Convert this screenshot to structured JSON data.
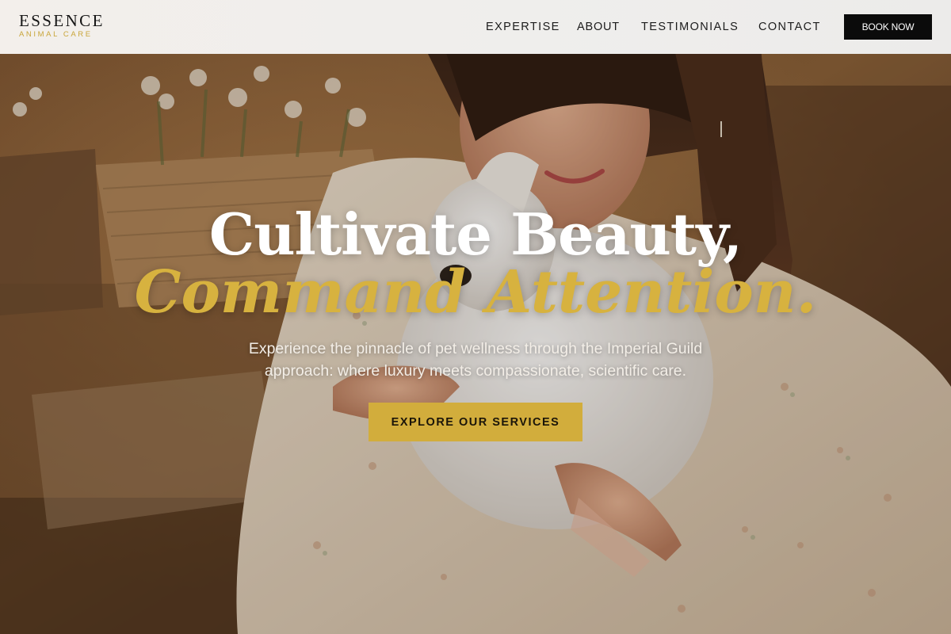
{
  "header": {
    "logo": {
      "name": "ESSENCE",
      "tagline": "ANIMAL CARE"
    },
    "nav": [
      {
        "label": "EXPERTISE"
      },
      {
        "label": "ABOUT"
      },
      {
        "label": "TESTIMONIALS"
      },
      {
        "label": "CONTACT"
      }
    ],
    "book_label": "BOOK NOW"
  },
  "hero": {
    "headline_line1": "Cultivate Beauty,",
    "headline_line2": "Command Attention.",
    "subtitle": "Experience the pinnacle of pet wellness through the Imperial Guild approach: where luxury meets compassionate, scientific care.",
    "cta_label": "EXPLORE OUR SERVICES",
    "image": "woman-holding-white-rabbit-photo"
  },
  "colors": {
    "accent_gold": "#d2ad3c",
    "headline_gold": "#d7b23f",
    "header_bg": "#efeeec",
    "button_dark": "#0b0b0b"
  }
}
